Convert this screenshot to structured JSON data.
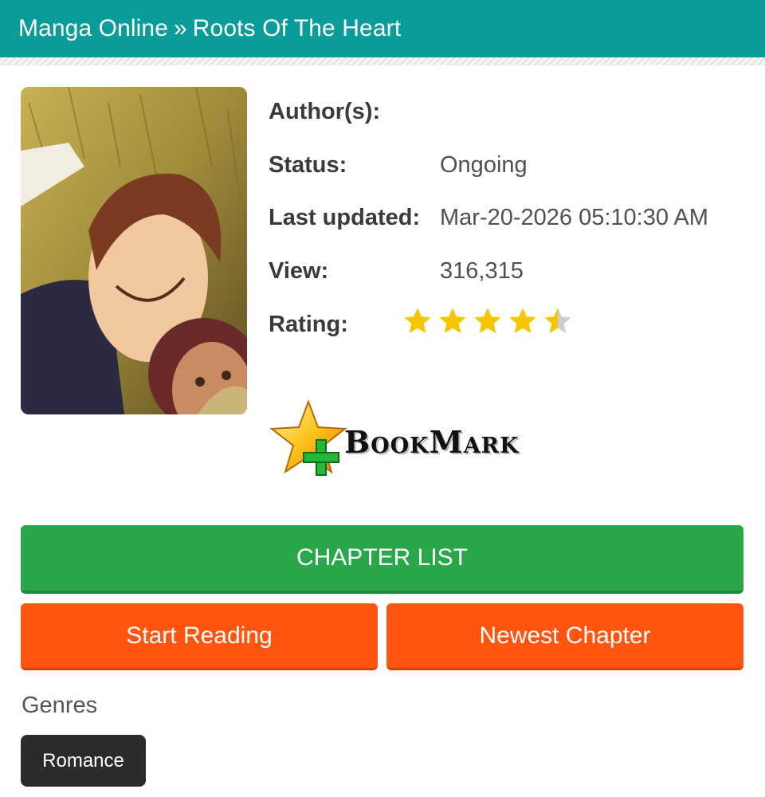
{
  "breadcrumb": {
    "home": "Manga Online",
    "separator": "»",
    "current": "Roots Of The Heart"
  },
  "cover": {
    "alt": "Roots Of The Heart cover"
  },
  "info": {
    "author_label": "Author(s):",
    "author_value": "",
    "status_label": "Status:",
    "status_value": "Ongoing",
    "updated_label": "Last updated:",
    "updated_value": "Mar-20-2026 05:10:30 AM",
    "view_label": "View:",
    "view_value": "316,315",
    "rating_label": "Rating:",
    "rating_value": 4.5,
    "rating_max": 5
  },
  "bookmark": {
    "label": "BookMark",
    "icon": "star-plus-icon"
  },
  "buttons": {
    "chapter_list": "CHAPTER LIST",
    "start_reading": "Start Reading",
    "newest_chapter": "Newest Chapter"
  },
  "genres": {
    "title": "Genres",
    "items": [
      "Romance"
    ]
  },
  "colors": {
    "header": "#0a9c98",
    "chapter_list_button": "#2aa74a",
    "action_button": "#ff5511",
    "genre_tag": "#2b2b2b",
    "star": "#f7c600"
  }
}
